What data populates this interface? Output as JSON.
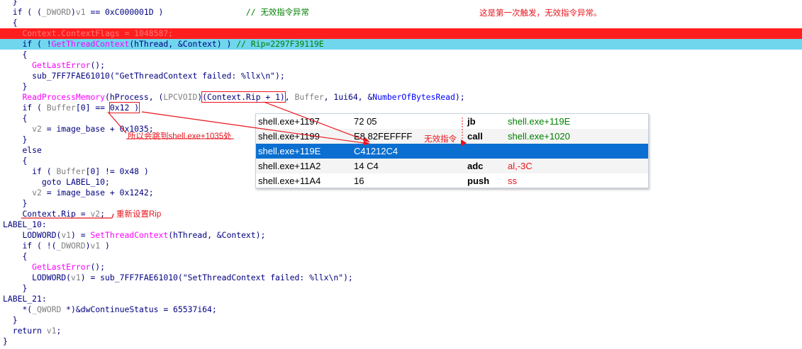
{
  "lines": [
    {
      "indent": 2,
      "tokens": [
        {
          "t": "}",
          "c": "p"
        }
      ]
    },
    {
      "indent": 2,
      "tokens": [
        {
          "t": "if ( (",
          "c": "p"
        },
        {
          "t": "_DWORD",
          "c": "gray"
        },
        {
          "t": ")",
          "c": "p"
        },
        {
          "t": "v1",
          "c": "gray"
        },
        {
          "t": " == 0xC000001D )                 ",
          "c": "p"
        },
        {
          "t": "// 无效指令异常",
          "c": "com"
        }
      ]
    },
    {
      "indent": 2,
      "tokens": [
        {
          "t": "{",
          "c": "p"
        }
      ]
    },
    {
      "indent": 4,
      "hl": "red",
      "tokens": [
        {
          "t": "Context.ContextFlags = 1048587;",
          "c": "hlred"
        }
      ]
    },
    {
      "indent": 4,
      "hl": "blue",
      "tokens": [
        {
          "t": "if ( !",
          "c": "p"
        },
        {
          "t": "GetThreadContext",
          "c": "fn"
        },
        {
          "t": "(hThread, &Context) ) ",
          "c": "p"
        },
        {
          "t": "// Rip=2297F39119E",
          "c": "com"
        }
      ]
    },
    {
      "indent": 4,
      "tokens": [
        {
          "t": "{",
          "c": "p"
        }
      ]
    },
    {
      "indent": 6,
      "tokens": [
        {
          "t": "GetLastError",
          "c": "fn"
        },
        {
          "t": "();",
          "c": "p"
        }
      ]
    },
    {
      "indent": 6,
      "tokens": [
        {
          "t": "sub_7FF7FAE61010(\"GetThreadContext failed: %llx\\n\");",
          "c": "p"
        }
      ]
    },
    {
      "indent": 4,
      "tokens": [
        {
          "t": "}",
          "c": "p"
        }
      ]
    },
    {
      "indent": 4,
      "tokens": [
        {
          "t": "ReadProcessMemory",
          "c": "fn"
        },
        {
          "t": "(hProcess, (",
          "c": "p"
        },
        {
          "t": "LPCVOID",
          "c": "gray"
        },
        {
          "t": ")",
          "c": "p"
        },
        {
          "t": "(Context.Rip + 1)",
          "c": "p",
          "box": true
        },
        {
          "t": ", ",
          "c": "p"
        },
        {
          "t": "Buffer",
          "c": "gray"
        },
        {
          "t": ", 1ui64, &",
          "c": "p"
        },
        {
          "t": "NumberOfBytesRead",
          "c": "var"
        },
        {
          "t": ");",
          "c": "p"
        }
      ]
    },
    {
      "indent": 4,
      "tokens": [
        {
          "t": "if ( ",
          "c": "p"
        },
        {
          "t": "Buffer",
          "c": "gray"
        },
        {
          "t": "[0] == ",
          "c": "p"
        },
        {
          "t": "0x12 )",
          "c": "p",
          "box": true
        }
      ]
    },
    {
      "indent": 4,
      "tokens": [
        {
          "t": "{",
          "c": "p"
        }
      ]
    },
    {
      "indent": 6,
      "tokens": [
        {
          "t": "v2",
          "c": "gray"
        },
        {
          "t": " = image_base + 0x1035;",
          "c": "p"
        }
      ]
    },
    {
      "indent": 4,
      "tokens": [
        {
          "t": "}",
          "c": "p"
        }
      ]
    },
    {
      "indent": 4,
      "tokens": [
        {
          "t": "else",
          "c": "p"
        }
      ]
    },
    {
      "indent": 4,
      "tokens": [
        {
          "t": "{",
          "c": "p"
        }
      ]
    },
    {
      "indent": 6,
      "tokens": [
        {
          "t": "if ( ",
          "c": "p"
        },
        {
          "t": "Buffer",
          "c": "gray"
        },
        {
          "t": "[0] != 0x48 )",
          "c": "p"
        }
      ]
    },
    {
      "indent": 8,
      "tokens": [
        {
          "t": "goto LABEL_10;",
          "c": "p"
        }
      ]
    },
    {
      "indent": 6,
      "tokens": [
        {
          "t": "v2",
          "c": "gray"
        },
        {
          "t": " = image_base + 0x1242;",
          "c": "p"
        }
      ]
    },
    {
      "indent": 4,
      "tokens": [
        {
          "t": "}",
          "c": "p"
        }
      ]
    },
    {
      "indent": 4,
      "tokens": [
        {
          "t": "Context.Rip = ",
          "c": "p"
        },
        {
          "t": "v2",
          "c": "gray"
        },
        {
          "t": ";",
          "c": "p"
        }
      ]
    },
    {
      "indent": 0,
      "tokens": [
        {
          "t": "LABEL_10:",
          "c": "lbl"
        }
      ]
    },
    {
      "indent": 4,
      "tokens": [
        {
          "t": "LODWORD",
          "c": "p"
        },
        {
          "t": "(",
          "c": "p"
        },
        {
          "t": "v1",
          "c": "gray"
        },
        {
          "t": ") = ",
          "c": "p"
        },
        {
          "t": "SetThreadContext",
          "c": "fn"
        },
        {
          "t": "(hThread, &Context);",
          "c": "p"
        }
      ]
    },
    {
      "indent": 4,
      "tokens": [
        {
          "t": "if ( !(",
          "c": "p"
        },
        {
          "t": "_DWORD",
          "c": "gray"
        },
        {
          "t": ")",
          "c": "p"
        },
        {
          "t": "v1",
          "c": "gray"
        },
        {
          "t": " )",
          "c": "p"
        }
      ]
    },
    {
      "indent": 4,
      "tokens": [
        {
          "t": "{",
          "c": "p"
        }
      ]
    },
    {
      "indent": 6,
      "tokens": [
        {
          "t": "GetLastError",
          "c": "fn"
        },
        {
          "t": "();",
          "c": "p"
        }
      ]
    },
    {
      "indent": 6,
      "tokens": [
        {
          "t": "LODWORD",
          "c": "p"
        },
        {
          "t": "(",
          "c": "p"
        },
        {
          "t": "v1",
          "c": "gray"
        },
        {
          "t": ") = sub_7FF7FAE61010(\"SetThreadContext failed: %llx\\n\");",
          "c": "p"
        }
      ]
    },
    {
      "indent": 4,
      "tokens": [
        {
          "t": "}",
          "c": "p"
        }
      ]
    },
    {
      "indent": 0,
      "tokens": [
        {
          "t": "LABEL_21:",
          "c": "lbl"
        }
      ]
    },
    {
      "indent": 4,
      "tokens": [
        {
          "t": "*(",
          "c": "p"
        },
        {
          "t": "_QWORD",
          "c": "gray"
        },
        {
          "t": " *)&dwContinueStatus = 65537i64;",
          "c": "p"
        }
      ]
    },
    {
      "indent": 2,
      "tokens": [
        {
          "t": "}",
          "c": "p"
        }
      ]
    },
    {
      "indent": 2,
      "tokens": [
        {
          "t": "return ",
          "c": "p"
        },
        {
          "t": "v1",
          "c": "gray"
        },
        {
          "t": ";",
          "c": "p"
        }
      ]
    },
    {
      "indent": 0,
      "tokens": [
        {
          "t": "}",
          "c": "p"
        }
      ]
    }
  ],
  "annotations": {
    "first_trigger": "这是第一次触发，无效指令异常。",
    "jump_note": "所以会跳到shell.exe+1035处",
    "invalid_instr": "无效指令",
    "reset_rip": "重新设置Rip"
  },
  "disasm": {
    "rows": [
      {
        "addr": "shell.exe+1197",
        "bytes": "72 05",
        "mnemonic": "jb",
        "operand": "shell.exe+119E",
        "op_color": "green"
      },
      {
        "addr": "shell.exe+1199",
        "bytes": "E8 82FEFFFF",
        "mnemonic": "call",
        "operand": "shell.exe+1020",
        "op_color": "green"
      },
      {
        "addr": "shell.exe+119E",
        "bytes": "C41212C4",
        "mnemonic": "",
        "operand": "",
        "selected": true
      },
      {
        "addr": "shell.exe+11A2",
        "bytes": "14 C4",
        "mnemonic": "adc",
        "operand": "al,-3C",
        "op_color": "red"
      },
      {
        "addr": "shell.exe+11A4",
        "bytes": "16",
        "mnemonic": "push",
        "operand": "ss",
        "op_color": "red"
      }
    ]
  },
  "colors": {
    "highlight_red": "#ff1e1e",
    "highlight_blue": "#70d6ee",
    "annotation_red": "#e8141c",
    "selection_blue": "#0a6fd0",
    "keyword_navy": "#000080",
    "function_magenta": "#ff00ff",
    "comment_green": "#008000",
    "variable_gray": "#808080"
  }
}
